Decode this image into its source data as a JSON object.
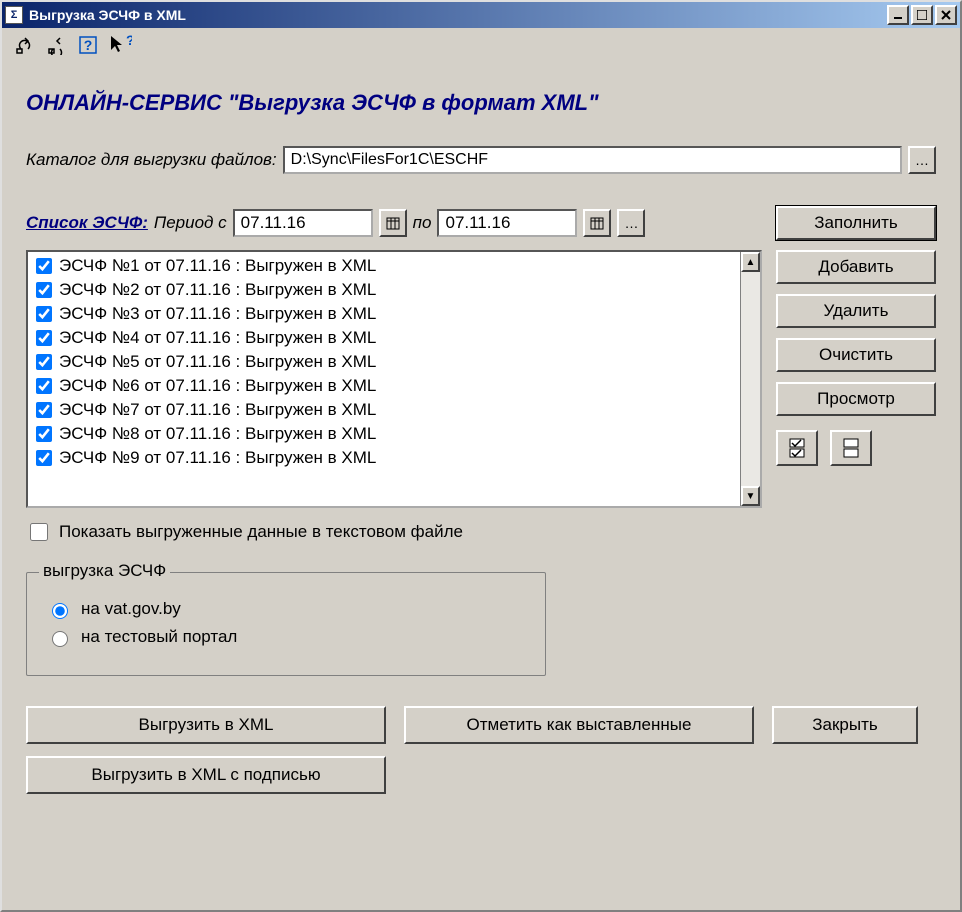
{
  "window": {
    "title": "Выгрузка ЭСЧФ в XML"
  },
  "heading": "ОНЛАЙН-СЕРВИС \"Выгрузка ЭСЧФ в формат XML\"",
  "catalog": {
    "label": "Каталог для выгрузки файлов:",
    "value": "D:\\Sync\\FilesFor1C\\ESCHF"
  },
  "period": {
    "list_label": "Список ЭСЧФ:",
    "from_label": "Период с",
    "to_label": "по",
    "from": "07.11.16",
    "to": "07.11.16"
  },
  "items": [
    "ЭСЧФ №1 от 07.11.16 : Выгружен в XML",
    "ЭСЧФ №2 от 07.11.16 : Выгружен в XML",
    "ЭСЧФ №3 от 07.11.16 : Выгружен в XML",
    "ЭСЧФ №4 от 07.11.16 : Выгружен в XML",
    "ЭСЧФ №5 от 07.11.16 : Выгружен в XML",
    "ЭСЧФ №6 от 07.11.16 : Выгружен в XML",
    "ЭСЧФ №7 от 07.11.16 : Выгружен в XML",
    "ЭСЧФ №8 от 07.11.16 : Выгружен в XML",
    "ЭСЧФ №9 от 07.11.16 : Выгружен в XML"
  ],
  "buttons": {
    "fill": "Заполнить",
    "add": "Добавить",
    "delete": "Удалить",
    "clear": "Очистить",
    "view": "Просмотр",
    "export_xml": "Выгрузить в XML",
    "mark_issued": "Отметить как выставленные",
    "close": "Закрыть",
    "export_xml_signed": "Выгрузить в XML с подписью"
  },
  "show_in_text": {
    "label": "Показать выгруженные данные в текстовом файле"
  },
  "group": {
    "caption": "выгрузка ЭСЧФ",
    "opt1": "на vat.gov.by",
    "opt2": "на тестовый портал"
  }
}
